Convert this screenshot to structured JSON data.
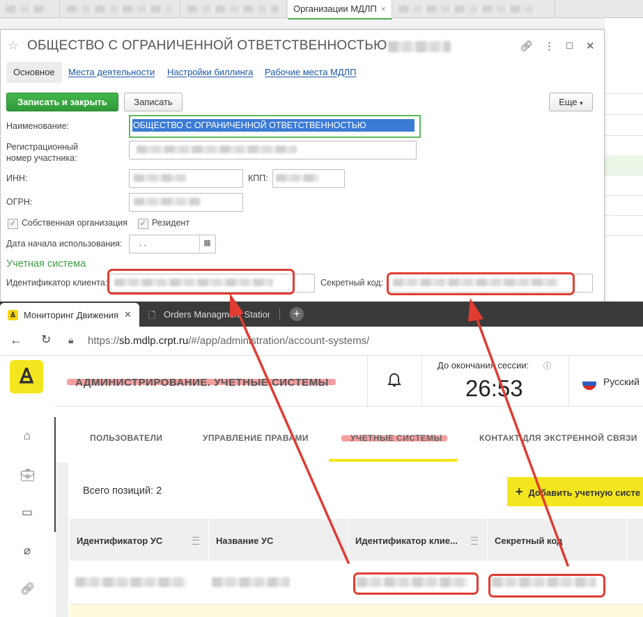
{
  "c1": {
    "active_tab_label": "Организации МДЛП",
    "close_glyph": "×",
    "dialog": {
      "title": "ОБЩЕСТВО С ОГРАНИЧЕННОЙ ОТВЕТСТВЕННОСТЬЮ",
      "tabs": {
        "main": "Основное",
        "places": "Места деятельности",
        "billing": "Настройки биллинга",
        "workplaces": "Рабочие места МДЛП"
      },
      "buttons": {
        "save_close": "Записать и закрыть",
        "save": "Записать",
        "more": "Еще"
      },
      "labels": {
        "name": "Наименование:",
        "reg_line1": "Регистрационный",
        "reg_line2": "номер участника:",
        "inn": "ИНН:",
        "kpp": "КПП:",
        "ogrn": "ОГРН:",
        "own_org": "Собственная организация",
        "resident": "Резидент",
        "start_date": "Дата начала использования:",
        "accounting_section": "Учетная система",
        "client_id": "Идентификатор клиента:",
        "secret_code": "Секретный код:"
      },
      "values": {
        "name": "ОБЩЕСТВО С ОГРАНИЧЕННОЙ ОТВЕТСТВЕННОСТЬЮ",
        "start_date": ". ."
      }
    }
  },
  "browser": {
    "tab1_title": "Мониторинг Движения",
    "tab2_title": "Orders Managment Station",
    "url_prefix": "https://",
    "url_main": "sb.mdlp.crpt.ru",
    "url_rest": "/#/app/administration/account-systems/"
  },
  "app": {
    "page_title": "АДМИНИСТРИРОВАНИЕ. УЧЕТНЫЕ СИСТЕМЫ",
    "session_label": "До окончания сессии:",
    "session_timer": "26:53",
    "language": "Русский",
    "nav": {
      "users": "ПОЛЬЗОВАТЕЛИ",
      "rights": "УПРАВЛЕНИЕ ПРАВАМИ",
      "systems": "УЧЕТНЫЕ СИСТЕМЫ",
      "emergency": "КОНТАКТ ДЛЯ ЭКСТРЕННОЙ СВЯЗИ"
    },
    "total_positions": "Всего позиций: 2",
    "add_button": "Добавить учетную систе",
    "table": {
      "columns": [
        "Идентификатор УС",
        "Название УС",
        "Идентификатор клие...",
        "Секретный код"
      ]
    }
  },
  "colors": {
    "accent_green": "#3aa043",
    "brand_yellow": "#f4e61e",
    "annotation_red": "#e03c31"
  }
}
